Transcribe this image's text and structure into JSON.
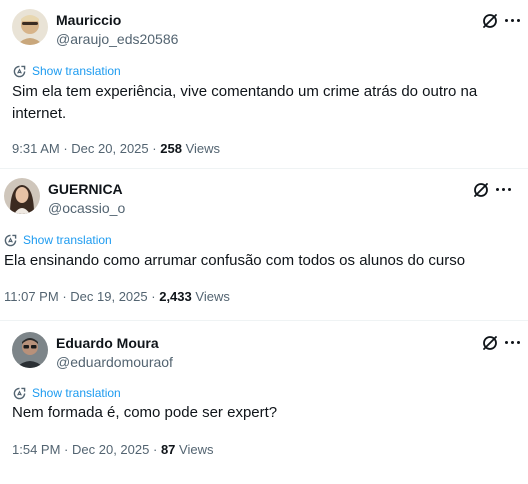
{
  "posts": [
    {
      "name": "Mauriccio",
      "handle": "@araujo_eds20586",
      "translate_label": "Show translation",
      "text": "Sim ela tem experiência, vive comentando um crime atrás do outro na internet.",
      "time": "9:31 AM",
      "date": "Dec 20, 2025",
      "views_count": "258",
      "views_label": "Views",
      "sep": "·"
    },
    {
      "name": "GUERNICA",
      "handle": "@ocassio_o",
      "translate_label": "Show translation",
      "text": "Ela ensinando como arrumar confusão com todos os alunos do curso",
      "time": "11:07 PM",
      "date": "Dec 19, 2025",
      "views_count": "2,433",
      "views_label": "Views",
      "sep": "·"
    },
    {
      "name": "Eduardo Moura",
      "handle": "@eduardomouraof",
      "translate_label": "Show translation",
      "text": "Nem formada é, como pode ser expert?",
      "time": "1:54 PM",
      "date": "Dec 20, 2025",
      "views_count": "87",
      "views_label": "Views",
      "sep": "·"
    }
  ],
  "colors": {
    "link": "#1d9bf0",
    "secondary": "#536471",
    "primary": "#0f1419"
  },
  "icons": [
    "grok-icon",
    "more-icon",
    "translate-icon"
  ]
}
